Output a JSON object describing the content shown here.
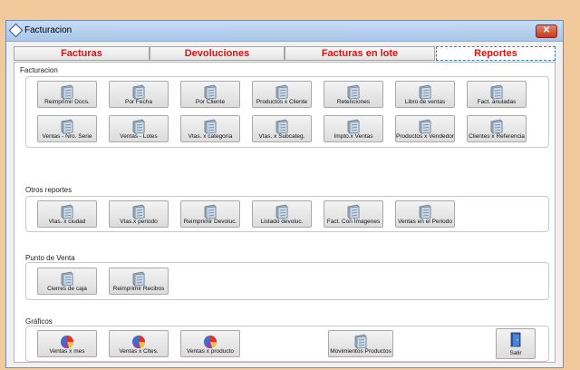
{
  "window": {
    "title": "Facturacion",
    "close_label": "✕"
  },
  "tabs": [
    {
      "label": "Facturas"
    },
    {
      "label": "Devoluciones"
    },
    {
      "label": "Facturas en lote"
    },
    {
      "label": "Reportes"
    }
  ],
  "sections": {
    "facturacion": {
      "label": "Facturacion",
      "buttons": [
        "Reimprimir Docs.",
        "Por Fecha",
        "Por Cliente",
        "Productos x Cliente",
        "Retenciones",
        "Libro de ventas",
        "Fact. anuladas",
        "Ventas - Nro. Serie",
        "Ventas - Lotes",
        "Vtas. x categoría",
        "Vtas. x Subcateg.",
        "Impto.x Ventas",
        "Productos x Vendedor",
        "Clientes x Referencia"
      ]
    },
    "otros": {
      "label": "Otros reportes",
      "buttons": [
        "Vtas. x ciudad",
        "Vtas.x periodo",
        "Reimprimir Devoluc.",
        "Listado devoluc.",
        "Fact. Con Imagenes",
        "Ventas en el Periodo"
      ]
    },
    "pdv": {
      "label": "Punto de Venta",
      "buttons": [
        "Cierres de caja",
        "Reimprimir Recibos"
      ]
    },
    "graficos": {
      "label": "Gráficos",
      "buttons": [
        "Ventas x mes",
        "Ventas x Cltes.",
        "Ventas x producto"
      ],
      "movimientos": "Movimientos Productos",
      "salir": "Salir"
    }
  }
}
